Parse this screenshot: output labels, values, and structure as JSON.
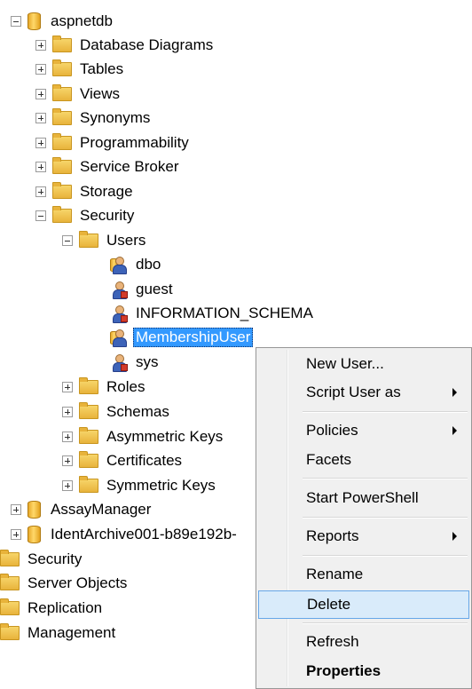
{
  "tree": {
    "root_db": "aspnetdb",
    "db_children": [
      "Database Diagrams",
      "Tables",
      "Views",
      "Synonyms",
      "Programmability",
      "Service Broker",
      "Storage"
    ],
    "security": "Security",
    "users": "Users",
    "user_items": [
      "dbo",
      "guest",
      "INFORMATION_SCHEMA",
      "MembershipUser",
      "sys"
    ],
    "security_children": [
      "Roles",
      "Schemas",
      "Asymmetric Keys",
      "Certificates",
      "Symmetric Keys"
    ],
    "other_dbs": [
      "AssayManager",
      "IdentArchive001-b89e192b-"
    ],
    "server_folders": [
      "Security",
      "Server Objects",
      "Replication",
      "Management"
    ],
    "selected_user": "MembershipUser"
  },
  "context_menu": {
    "items": [
      {
        "label": "New User..."
      },
      {
        "label": "Script User as"
      },
      {
        "label": "Policies"
      },
      {
        "label": "Facets"
      },
      {
        "label": "Start PowerShell"
      },
      {
        "label": "Reports"
      },
      {
        "label": "Rename"
      },
      {
        "label": "Delete"
      },
      {
        "label": "Refresh"
      },
      {
        "label": "Properties"
      }
    ],
    "highlighted": "Delete"
  },
  "colors": {
    "selection": "#3399ff",
    "menu_highlight": "#d9ebfa",
    "folder": "#e8b33b"
  }
}
